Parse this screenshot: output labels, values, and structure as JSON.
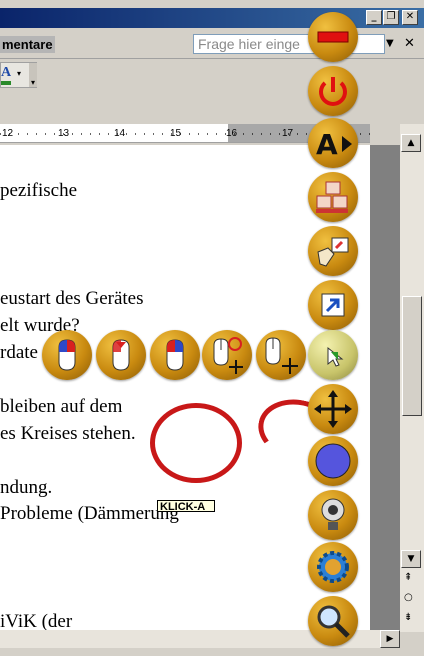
{
  "window": {
    "title_bar_buttons": [
      "_",
      "❐",
      "✕"
    ],
    "menu_item_fragment": "mentare",
    "ask_placeholder": "Frage hier einge",
    "doc_close": "✕",
    "ask_dropdown": "▼"
  },
  "toolbar": {
    "font_color_glyph": "A",
    "font_color_arrow": "▾",
    "more_glyph": "▾"
  },
  "ruler": {
    "numbers": [
      "12",
      "13",
      "14",
      "15",
      "16",
      "17"
    ]
  },
  "document": {
    "lines": [
      "pezifische",
      "eustart des Gerätes",
      "elt wurde?",
      "rdate",
      "bleiben auf dem",
      "es Kreises stehen.",
      "ndung.",
      "Probleme (Dämmerung",
      "iViK (der"
    ]
  },
  "tooltip": {
    "text": "KLICK-A"
  },
  "scrollbar": {
    "up": "▲",
    "down": "▼",
    "right": "▶",
    "browse_prev": "⇞",
    "browse_select": "○",
    "browse_next": "⇟"
  },
  "radial_menu": {
    "vertical_icons": [
      "minimize-icon",
      "power-icon",
      "text-size-icon",
      "keyboard-icon",
      "drag-drop-icon",
      "shortcut-arrow-icon",
      "green-arrow-mouse-icon",
      "move-cross-icon",
      "blue-circle-icon",
      "webcam-icon",
      "gear-icon",
      "magnifier-icon"
    ],
    "horizontal_icons": [
      "mouse-left-click-icon",
      "mouse-double-click-icon",
      "mouse-right-click-icon",
      "mouse-drag-one-icon",
      "mouse-move-icon"
    ]
  },
  "colors": {
    "orb": "#d99a1a",
    "red": "#c81818",
    "title_blue": "#0a246a"
  }
}
